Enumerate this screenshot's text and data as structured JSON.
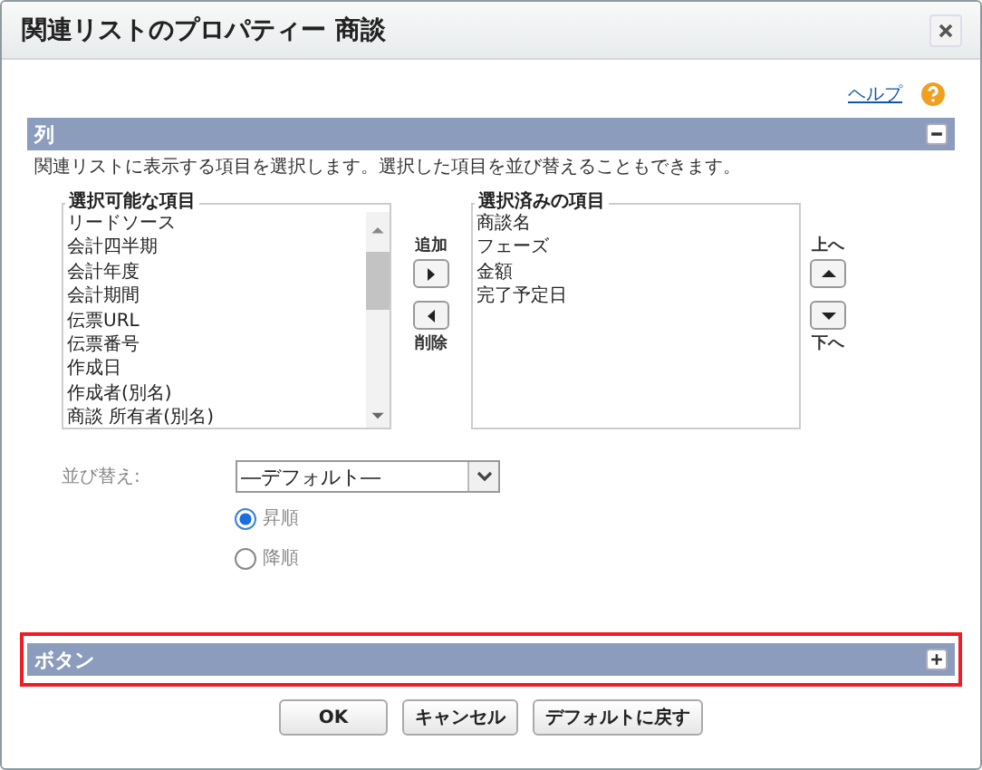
{
  "window": {
    "title": "関連リストのプロパティー 商談"
  },
  "help": {
    "label": "ヘルプ"
  },
  "sections": [
    {
      "kind": "columns",
      "title": "列",
      "expanded": true,
      "highlighted": false,
      "description": "関連リストに表示する項目を選択します。選択した項目を並び替えることもできます。"
    },
    {
      "kind": "buttons",
      "title": "ボタン",
      "expanded": false,
      "highlighted": true
    }
  ],
  "available": {
    "legend": "選択可能な項目",
    "items": [
      "リードソース",
      "会計四半期",
      "会計年度",
      "会計期間",
      "伝票URL",
      "伝票番号",
      "作成日",
      "作成者(別名)",
      "商談 所有者(別名)"
    ]
  },
  "move": {
    "add": "追加",
    "remove": "削除"
  },
  "selected": {
    "legend": "選択済みの項目",
    "items": [
      "商談名",
      "フェーズ",
      "金額",
      "完了予定日"
    ]
  },
  "order": {
    "up": "上へ",
    "down": "下へ"
  },
  "sort": {
    "label": "並び替え:",
    "value": "―デフォルト―",
    "options": [
      {
        "label": "昇順",
        "selected": true
      },
      {
        "label": "降順",
        "selected": false
      }
    ]
  },
  "buttons": [
    "OK",
    "キャンセル",
    "デフォルトに戻す"
  ]
}
